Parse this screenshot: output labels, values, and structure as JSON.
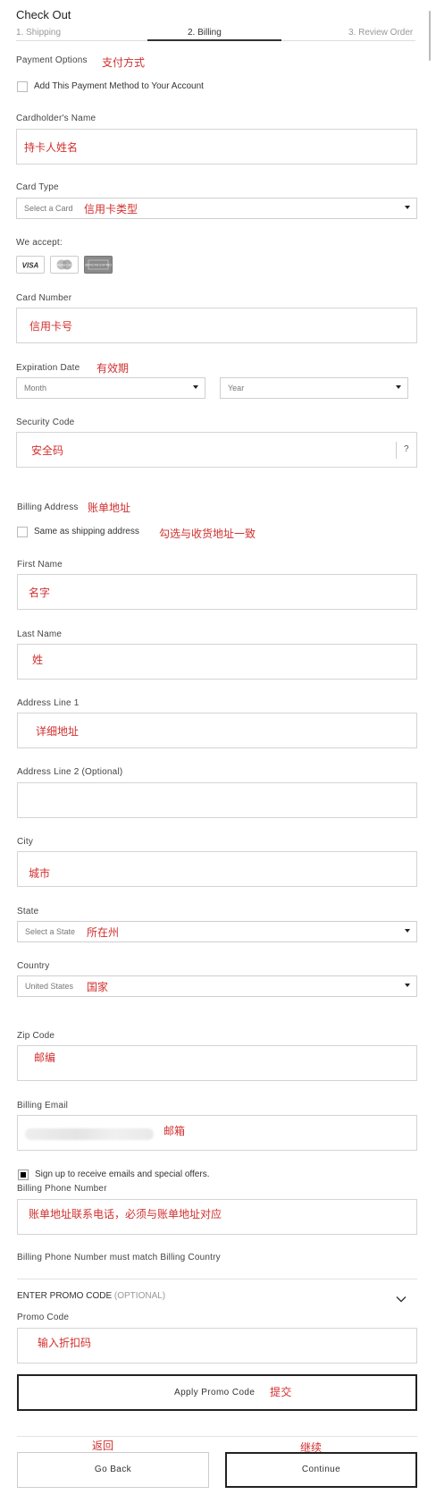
{
  "header": {
    "title": "Check Out",
    "steps": [
      "1. Shipping",
      "2. Billing",
      "3. Review Order"
    ]
  },
  "payment": {
    "options_label": "Payment Options",
    "options_note": "支付方式",
    "add_method_label": "Add This Payment Method to Your Account",
    "cardholder_label": "Cardholder's Name",
    "cardholder_value": "持卡人姓名",
    "card_type_label": "Card Type",
    "card_type_placeholder": "Select a Card",
    "card_type_note": "信用卡类型",
    "we_accept_label": "We accept:",
    "accepted_cards": [
      "VISA",
      "MasterCard",
      "American Express"
    ],
    "card_number_label": "Card Number",
    "card_number_value": "信用卡号",
    "expiration_label": "Expiration Date",
    "expiration_note": "有效期",
    "month_placeholder": "Month",
    "year_placeholder": "Year",
    "security_label": "Security Code",
    "security_value": "安全码",
    "security_help": "?"
  },
  "billing": {
    "address_label": "Billing Address",
    "address_note": "账单地址",
    "same_as_shipping_label": "Same as shipping address",
    "same_as_shipping_note": "勾选与收货地址一致",
    "first_name_label": "First Name",
    "first_name_value": "名字",
    "last_name_label": "Last Name",
    "last_name_value": "姓",
    "address1_label": "Address Line 1",
    "address1_value": "详细地址",
    "address2_label": "Address Line 2 (Optional)",
    "address2_value": "",
    "city_label": "City",
    "city_value": "城市",
    "state_label": "State",
    "state_placeholder": "Select a State",
    "state_note": "所在州",
    "country_label": "Country",
    "country_value": "United States",
    "country_note": "国家",
    "zip_label": "Zip Code",
    "zip_value": "邮编",
    "email_label": "Billing Email",
    "email_note": "邮箱",
    "signup_label": "Sign up to receive emails and special offers.",
    "signup_checked": true,
    "phone_label": "Billing Phone Number",
    "phone_value": "账单地址联系电话，必须与账单地址对应",
    "phone_hint": "Billing Phone Number must match Billing Country"
  },
  "promo": {
    "section_title": "ENTER PROMO CODE",
    "section_optional": "(OPTIONAL)",
    "code_label": "Promo Code",
    "code_value": "输入折扣码",
    "apply_label": "Apply Promo Code",
    "apply_note": "提交"
  },
  "footer": {
    "back_note": "返回",
    "continue_note": "继续",
    "back_label": "Go Back",
    "continue_label": "Continue"
  },
  "colors": {
    "annotation": "#d0302e",
    "text": "#333333",
    "border": "#d4d4d4"
  }
}
